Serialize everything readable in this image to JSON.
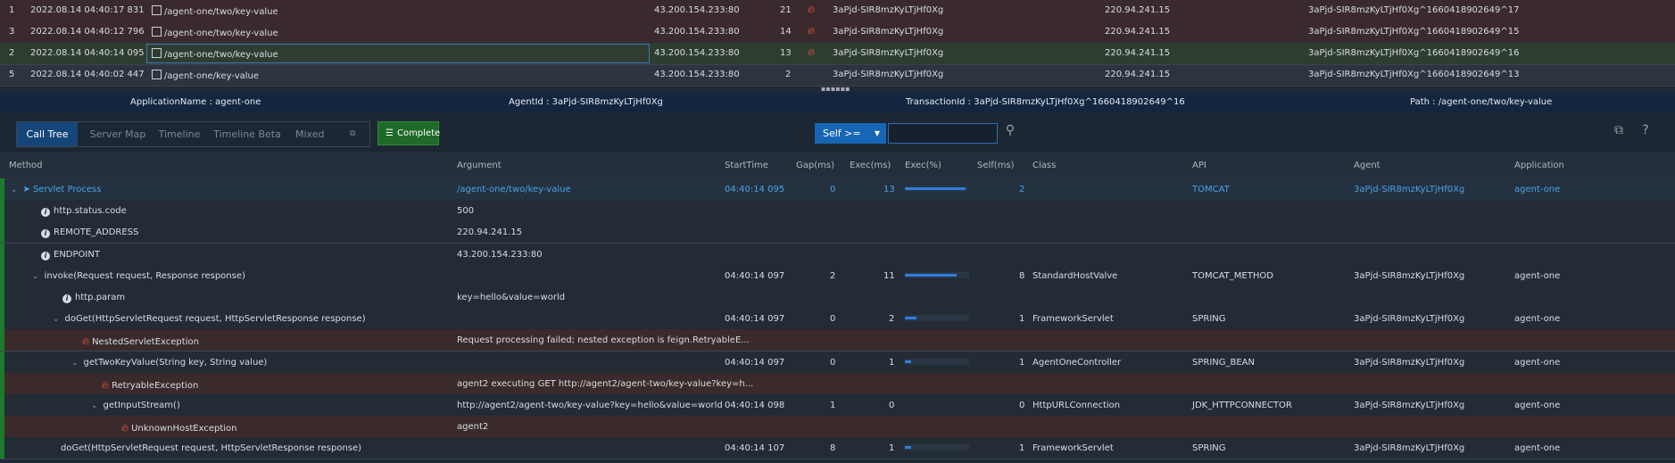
{
  "transactions": [
    {
      "idx": "1",
      "time": "2022.08.14 04:40:17 831",
      "path": "/agent-one/two/key-value",
      "endpoint": "43.200.154.233:80",
      "exec": "21",
      "error": true,
      "agent": "3aPjd-SIR8mzKyLTjHf0Xg",
      "remote": "220.94.241.15",
      "txid": "3aPjd-SIR8mzKyLTjHf0Xg^1660418902649^17"
    },
    {
      "idx": "3",
      "time": "2022.08.14 04:40:12 796",
      "path": "/agent-one/two/key-value",
      "endpoint": "43.200.154.233:80",
      "exec": "14",
      "error": true,
      "agent": "3aPjd-SIR8mzKyLTjHf0Xg",
      "remote": "220.94.241.15",
      "txid": "3aPjd-SIR8mzKyLTjHf0Xg^1660418902649^15"
    },
    {
      "idx": "2",
      "time": "2022.08.14 04:40:14 095",
      "path": "/agent-one/two/key-value",
      "endpoint": "43.200.154.233:80",
      "exec": "13",
      "error": true,
      "agent": "3aPjd-SIR8mzKyLTjHf0Xg",
      "remote": "220.94.241.15",
      "txid": "3aPjd-SIR8mzKyLTjHf0Xg^1660418902649^16"
    },
    {
      "idx": "5",
      "time": "2022.08.14 04:40:02 447",
      "path": "/agent-one/key-value",
      "endpoint": "43.200.154.233:80",
      "exec": "2",
      "error": false,
      "agent": "3aPjd-SIR8mzKyLTjHf0Xg",
      "remote": "220.94.241.15",
      "txid": "3aPjd-SIR8mzKyLTjHf0Xg^1660418902649^13"
    }
  ],
  "info": {
    "app": "ApplicationName : agent-one",
    "agent": "AgentId : 3aPjd-SIR8mzKyLTjHf0Xg",
    "tx": "TransactionId : 3aPjd-SIR8mzKyLTjHf0Xg^1660418902649^16",
    "path": "Path : /agent-one/two/key-value"
  },
  "tabs": [
    "Call Tree",
    "Server Map",
    "Timeline",
    "Timeline Beta",
    "Mixed View"
  ],
  "complete_label": "Complete",
  "filter": {
    "select": "Self >=",
    "search_value": ""
  },
  "columns": [
    "Method",
    "Argument",
    "StartTime",
    "Gap(ms)",
    "Exec(ms)",
    "Exec(%)",
    "Self(ms)",
    "Class",
    "API",
    "Agent",
    "Application"
  ],
  "colors": {
    "accent": "#15467a",
    "error_row": "#3b2a2c",
    "exec_bar": "#2c7fe0",
    "link": "#4ba3e3"
  },
  "rows": [
    {
      "method": "Servlet Process",
      "arg": "/agent-one/two/key-value",
      "start": "04:40:14 095",
      "gap": "0",
      "exec": "13",
      "pct": 0.95,
      "self": "2",
      "cls": "",
      "api": "TOMCAT",
      "agent": "3aPjd-SIR8mzKyLTjHf0Xg",
      "app": "agent-one"
    },
    {
      "method": "http.status.code",
      "arg": "500"
    },
    {
      "method": "REMOTE_ADDRESS",
      "arg": "220.94.241.15"
    },
    {
      "method": "ENDPOINT",
      "arg": "43.200.154.233:80"
    },
    {
      "method": "invoke(Request request, Response response)",
      "arg": "",
      "start": "04:40:14 097",
      "gap": "2",
      "exec": "11",
      "pct": 0.8,
      "self": "8",
      "cls": "StandardHostValve",
      "api": "TOMCAT_METHOD",
      "agent": "3aPjd-SIR8mzKyLTjHf0Xg",
      "app": "agent-one"
    },
    {
      "method": "http.param",
      "arg": "key=hello&value=world"
    },
    {
      "method": "doGet(HttpServletRequest request, HttpServletResponse response)",
      "arg": "",
      "start": "04:40:14 097",
      "gap": "0",
      "exec": "2",
      "pct": 0.18,
      "self": "1",
      "cls": "FrameworkServlet",
      "api": "SPRING",
      "agent": "3aPjd-SIR8mzKyLTjHf0Xg",
      "app": "agent-one"
    },
    {
      "method": "NestedServletException",
      "arg": "Request processing failed; nested exception is feign.RetryableE..."
    },
    {
      "method": "getTwoKeyValue(String key, String value)",
      "arg": "",
      "start": "04:40:14 097",
      "gap": "0",
      "exec": "1",
      "pct": 0.1,
      "self": "1",
      "cls": "AgentOneController",
      "api": "SPRING_BEAN",
      "agent": "3aPjd-SIR8mzKyLTjHf0Xg",
      "app": "agent-one"
    },
    {
      "method": "RetryableException",
      "arg": "agent2 executing GET http://agent2/agent-two/key-value?key=h..."
    },
    {
      "method": "getInputStream()",
      "arg": "http://agent2/agent-two/key-value?key=hello&value=world",
      "start": "04:40:14 098",
      "gap": "1",
      "exec": "0",
      "pct": 0,
      "self": "0",
      "cls": "HttpURLConnection",
      "api": "JDK_HTTPCONNECTOR",
      "agent": "3aPjd-SIR8mzKyLTjHf0Xg",
      "app": "agent-one"
    },
    {
      "method": "UnknownHostException",
      "arg": "agent2"
    },
    {
      "method": "doGet(HttpServletRequest request, HttpServletResponse response)",
      "arg": "",
      "start": "04:40:14 107",
      "gap": "8",
      "exec": "1",
      "pct": 0.1,
      "self": "1",
      "cls": "FrameworkServlet",
      "api": "SPRING",
      "agent": "3aPjd-SIR8mzKyLTjHf0Xg",
      "app": "agent-one"
    }
  ]
}
